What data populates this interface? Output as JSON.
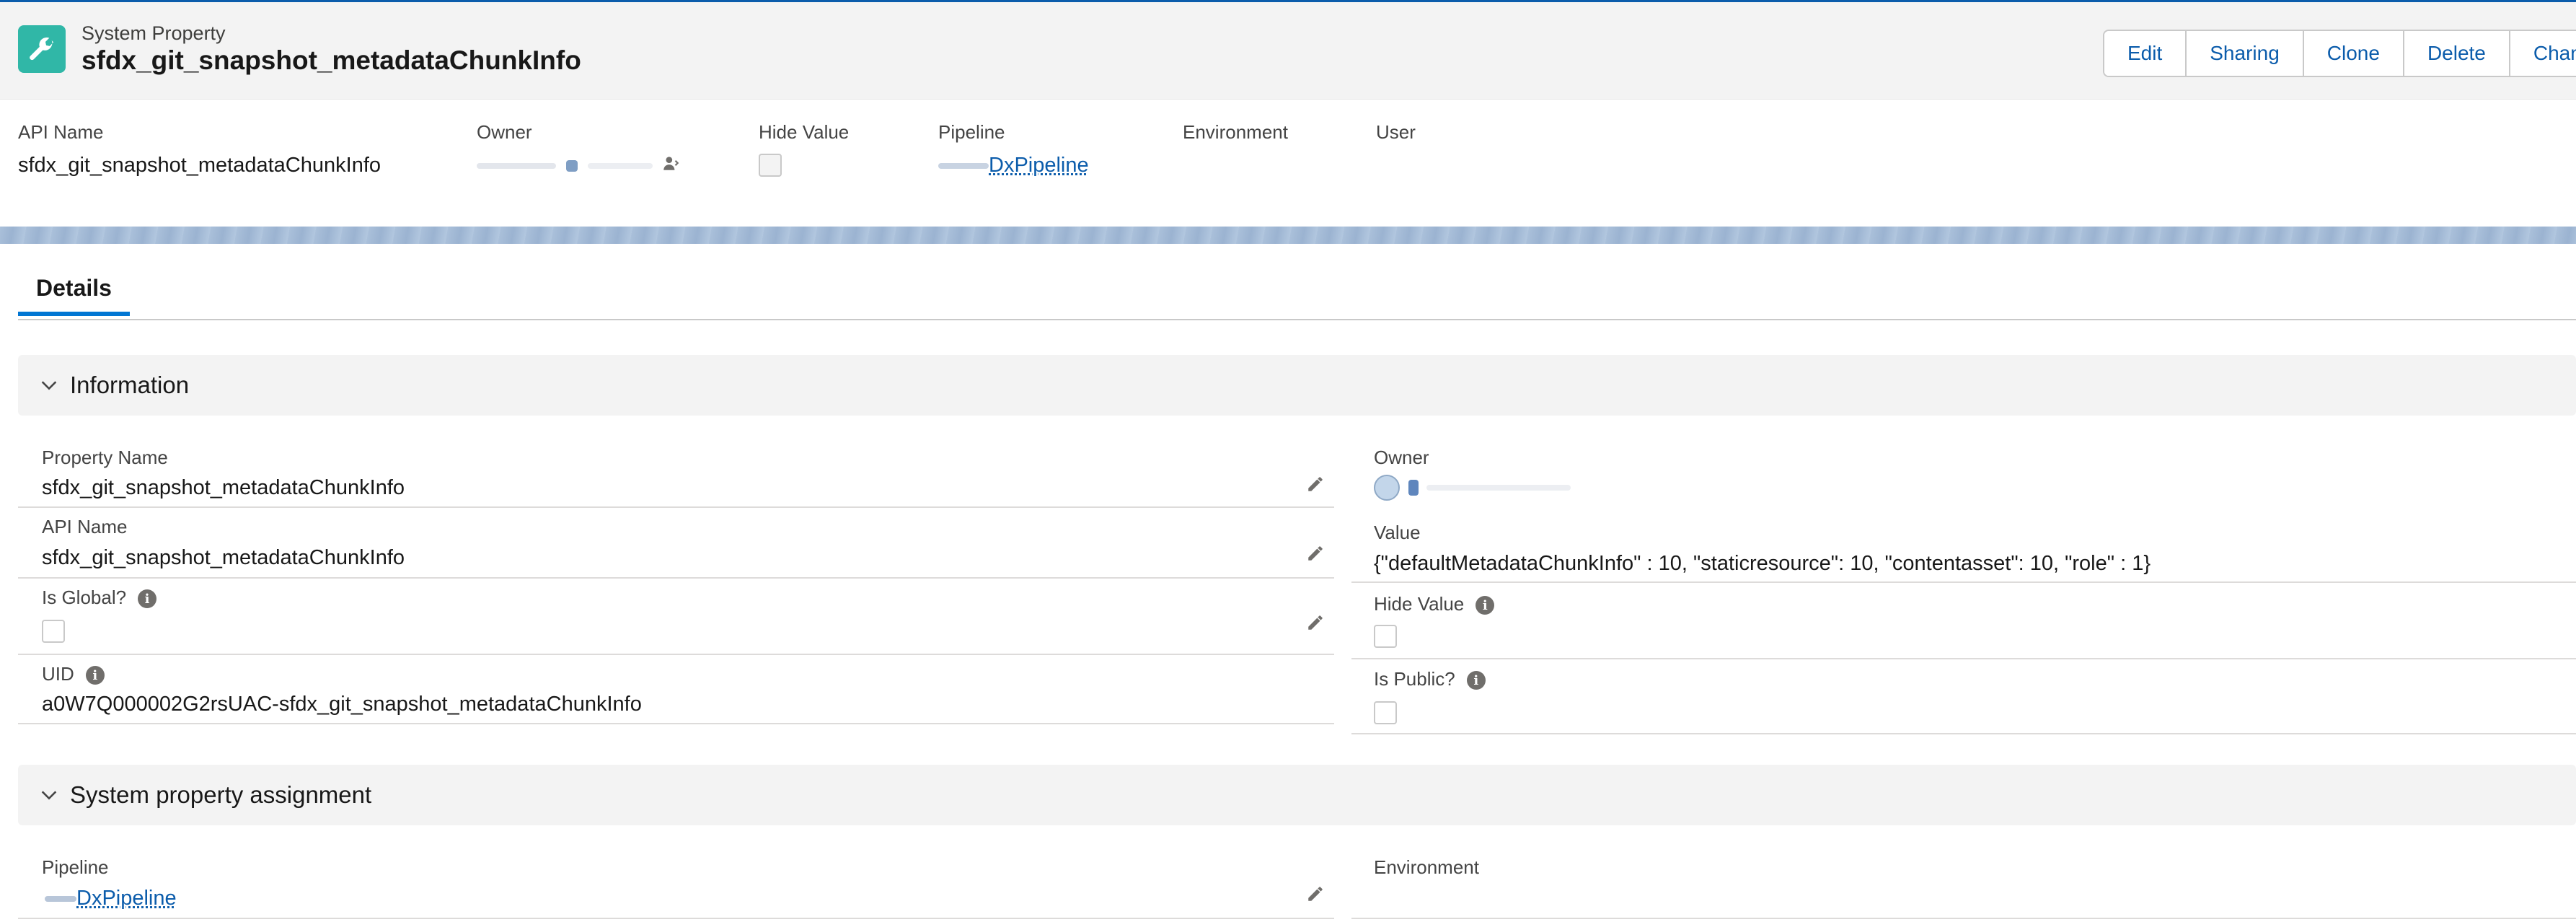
{
  "header": {
    "object_type": "System Property",
    "record_title": "sfdx_git_snapshot_metadataChunkInfo",
    "icon": "wrench-icon",
    "buttons": [
      "Edit",
      "Sharing",
      "Clone",
      "Delete",
      "Chang"
    ]
  },
  "highlights": {
    "api_name_label": "API Name",
    "api_name_value": "sfdx_git_snapshot_metadataChunkInfo",
    "owner_label": "Owner",
    "hide_value_label": "Hide Value",
    "hide_value_checked": false,
    "pipeline_label": "Pipeline",
    "pipeline_value": "DxPipeline",
    "environment_label": "Environment",
    "user_label": "User"
  },
  "tabs": {
    "details": "Details"
  },
  "information": {
    "title": "Information",
    "property_name_label": "Property Name",
    "property_name_value": "sfdx_git_snapshot_metadataChunkInfo",
    "api_name_label": "API Name",
    "api_name_value": "sfdx_git_snapshot_metadataChunkInfo",
    "is_global_label": "Is Global?",
    "is_global_checked": false,
    "uid_label": "UID",
    "uid_value": "a0W7Q000002G2rsUAC-sfdx_git_snapshot_metadataChunkInfo",
    "owner_label": "Owner",
    "owner_value": "",
    "value_label": "Value",
    "value_value": "{\"defaultMetadataChunkInfo\" : 10, \"staticresource\": 10, \"contentasset\": 10, \"role\" : 1}",
    "hide_value_label": "Hide Value",
    "hide_value_checked": false,
    "is_public_label": "Is Public?",
    "is_public_checked": false
  },
  "assignment": {
    "title": "System property assignment",
    "pipeline_label": "Pipeline",
    "pipeline_value": "DxPipeline",
    "environment_label": "Environment"
  },
  "colors": {
    "brand": "#0176d3",
    "link": "#0b5cab",
    "object_icon": "#30b7a7",
    "header_bg": "#f3f3f3"
  }
}
